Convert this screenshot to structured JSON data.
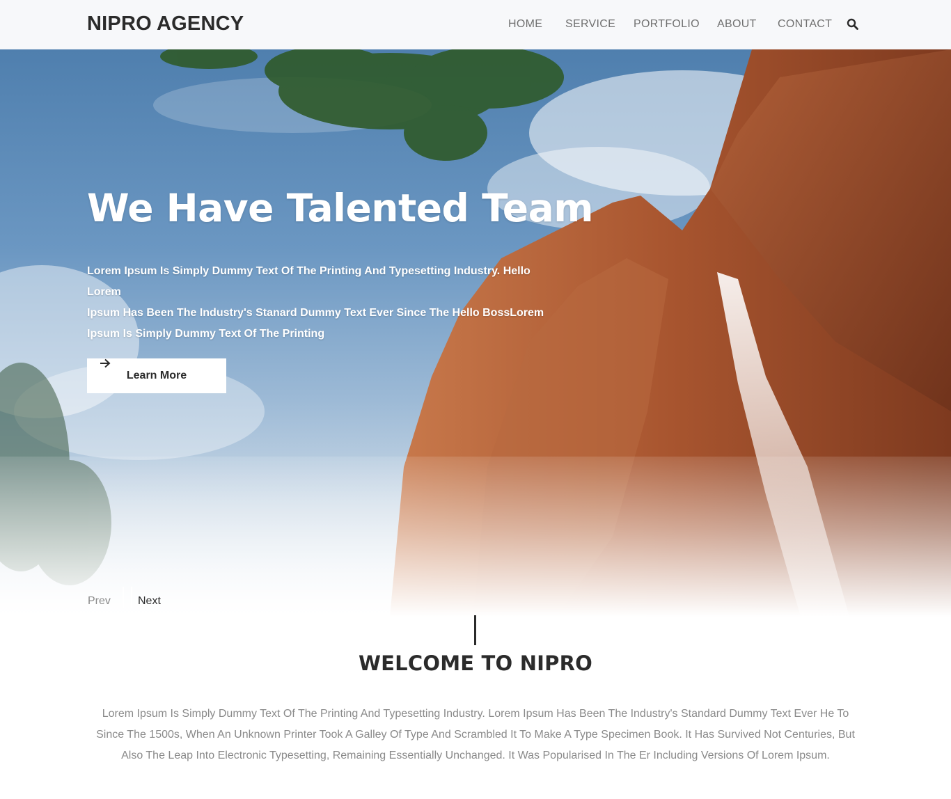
{
  "header": {
    "logo": "NIPRO AGENCY",
    "nav": [
      "HOME",
      "SERVICE",
      "PORTFOLIO",
      "ABOUT",
      "CONTACT"
    ],
    "search_icon": "search-icon"
  },
  "hero": {
    "title": "We Have Talented Team",
    "lines": [
      "Lorem Ipsum Is Simply Dummy Text Of The Printing And Typesetting Industry. Hello Lorem",
      "Ipsum Has Been The Industry's Stanard Dummy Text Ever Since The Hello BossLorem",
      "Ipsum Is Simply Dummy Text Of The Printing"
    ],
    "button_label": "Learn More",
    "button_icon": "arrow-right-icon",
    "prev_label": "Prev",
    "next_label": "Next"
  },
  "welcome": {
    "title": "WELCOME TO NIPRO",
    "text": "Lorem Ipsum Is Simply Dummy Text Of The Printing And Typesetting Industry. Lorem Ipsum Has Been The Industry's Standard Dummy Text Ever He To Since The 1500s, When An Unknown Printer Took A Galley Of Type And Scrambled It To Make A Type Specimen Book. It Has Survived Not Centuries, But Also The Leap Into Electronic Typesetting, Remaining Essentially Unchanged. It Was Popularised In The Er Including Versions Of Lorem Ipsum."
  },
  "colors": {
    "header_bg": "#f7f8fa",
    "text_dark": "#2b2b2b",
    "text_muted": "#8a8a8a",
    "cliff": "#a8552f"
  }
}
